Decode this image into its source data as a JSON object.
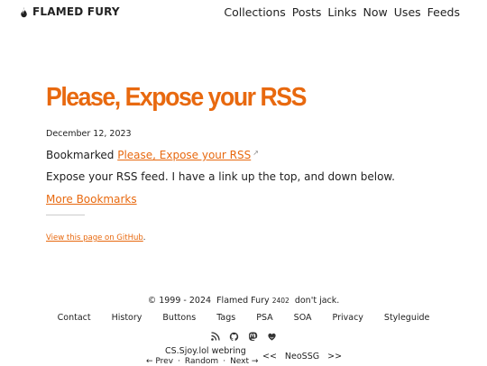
{
  "site": {
    "name": "FLAMED FURY"
  },
  "nav": [
    "Collections",
    "Posts",
    "Links",
    "Now",
    "Uses",
    "Feeds"
  ],
  "post": {
    "title": "Please, Expose your RSS",
    "date": "December 12, 2023",
    "bookmarked_prefix": "Bookmarked",
    "bookmark_link": "Please, Expose your RSS",
    "external_mark": "↗",
    "body": "Expose your RSS feed. I have a link up the top, and down below.",
    "more_link": "More Bookmarks",
    "github_link": "View this page on GitHub",
    "github_suffix": "."
  },
  "footer": {
    "copyright_prefix": "© 1999 - 2024",
    "author": "Flamed Fury",
    "version": "2402",
    "tagline": "don't jack.",
    "links": [
      "Contact",
      "History",
      "Buttons",
      "Tags",
      "PSA",
      "SOA",
      "Privacy",
      "Styleguide"
    ],
    "webring": {
      "name": "CS.Sjoy.lol",
      "label": "webring",
      "prev": "← Prev",
      "sep1": "·",
      "random": "Random",
      "sep2": "·",
      "next": "Next →",
      "left": "<<",
      "center": "NeoSSG",
      "right": ">>"
    }
  },
  "colors": {
    "accent": "#e8690f",
    "text": "#222222",
    "background": "#ffffff"
  },
  "icons": [
    "flame-icon",
    "rss-icon",
    "github-icon",
    "mastodon-icon",
    "heart-icon"
  ]
}
